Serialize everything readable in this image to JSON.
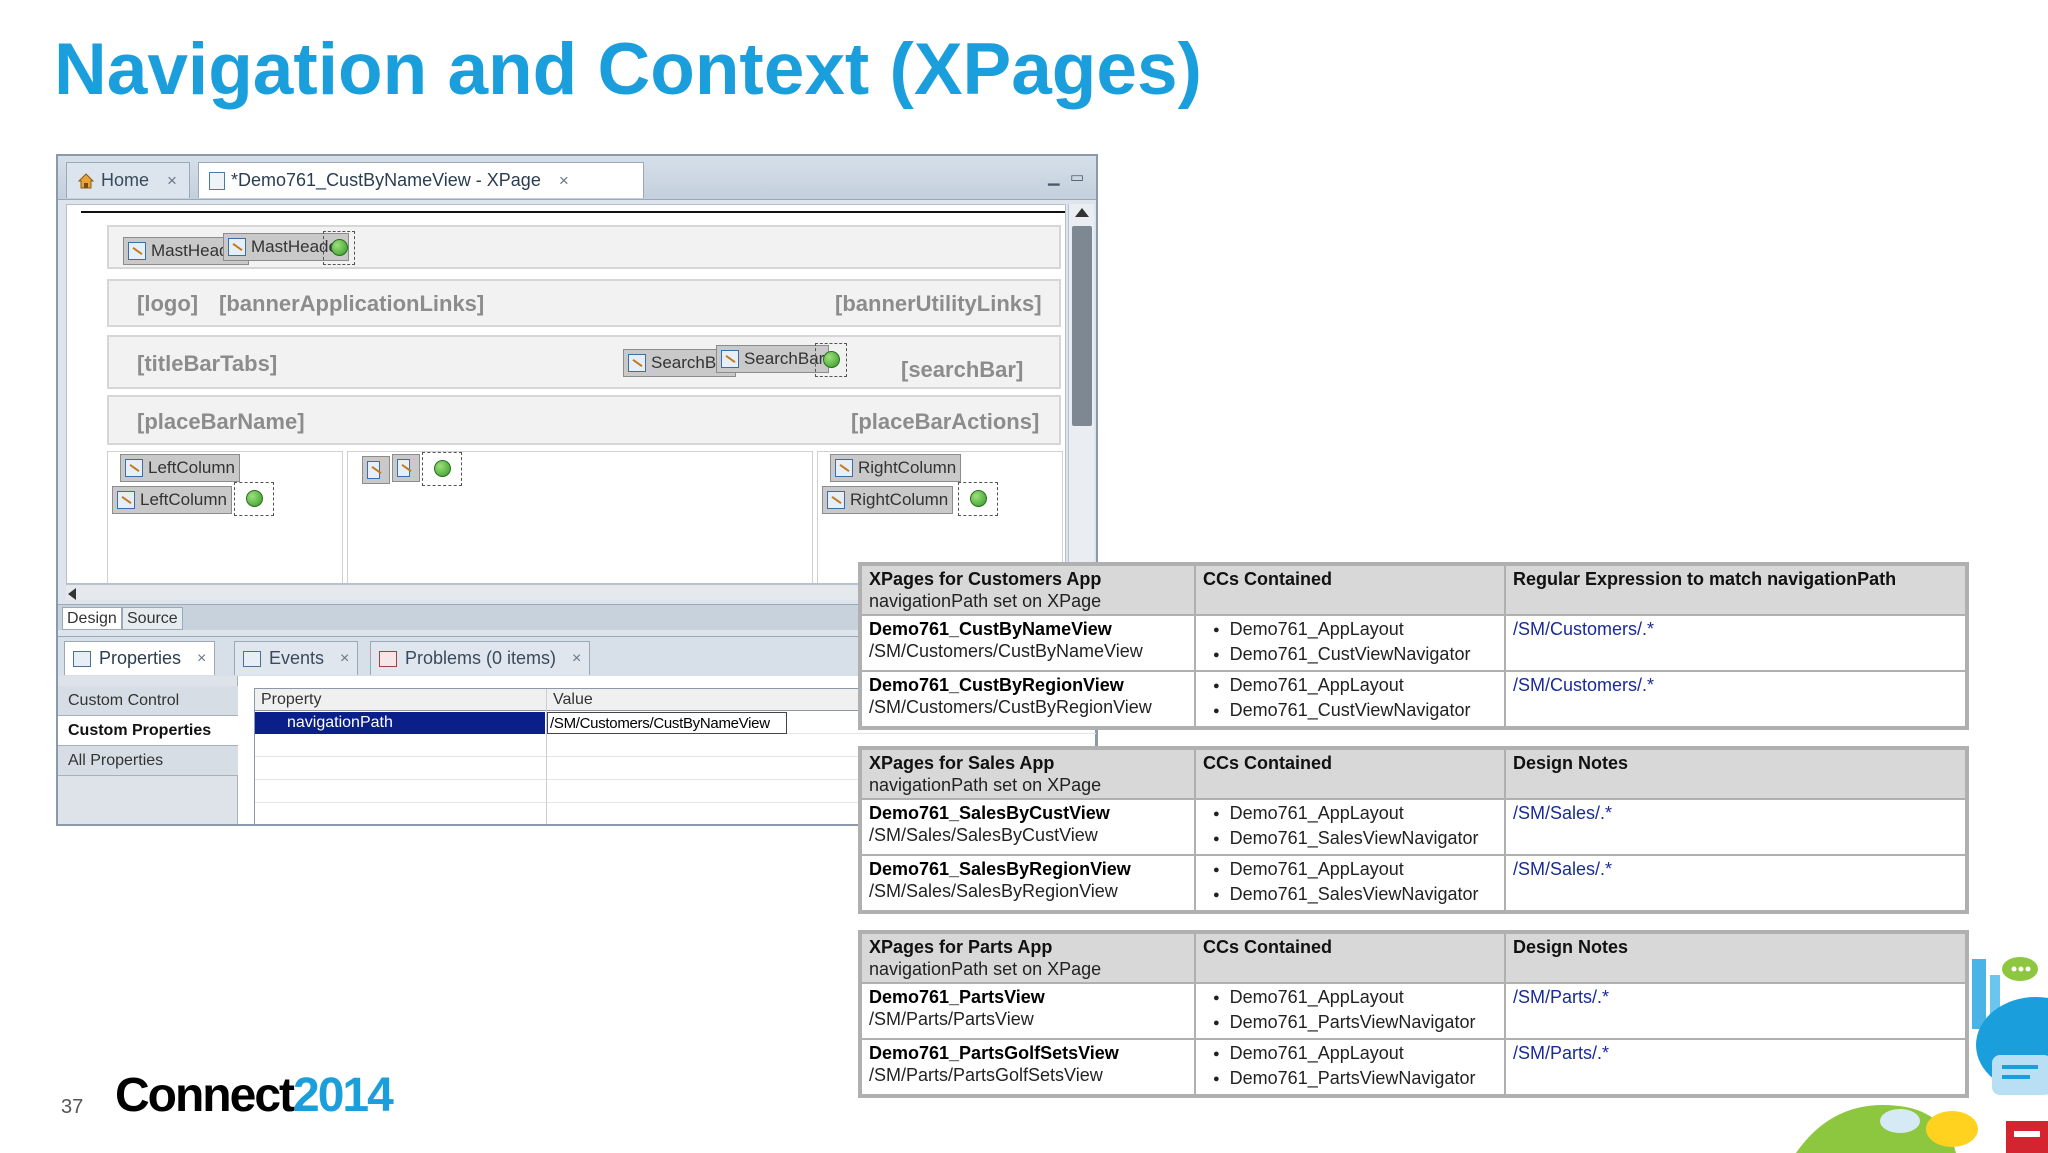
{
  "slide": {
    "title": "Navigation and Context (XPages)",
    "page_number": "37",
    "logo_word": "Connect",
    "logo_year": "2014"
  },
  "editor": {
    "tabs": [
      {
        "label": "Home",
        "close": "×"
      },
      {
        "label": "*Demo761_CustByNameView - XPage",
        "close": "×"
      }
    ],
    "window_controls": {
      "minimize": "▁",
      "maximize": "▭"
    },
    "canvas": {
      "mast_header": [
        "MastHeader",
        "MastHeader"
      ],
      "placeholders": {
        "logo": "[logo]",
        "banner_app_links": "[bannerApplicationLinks]",
        "banner_utility_links": "[bannerUtilityLinks]",
        "title_bar_tabs": "[titleBarTabs]",
        "search_bar": "[searchBar]",
        "place_bar_name": "[placeBarName]",
        "place_bar_actions": "[placeBarActions]"
      },
      "search_bar_ccs": [
        "SearchBar",
        "SearchBar"
      ],
      "left_column_ccs": [
        "LeftColumn",
        "LeftColumn"
      ],
      "right_column_ccs": [
        "RightColumn",
        "RightColumn"
      ]
    },
    "design_tabs": [
      "Design",
      "Source"
    ],
    "panel_tabs": [
      {
        "label": "Properties",
        "close": "×"
      },
      {
        "label": "Events",
        "close": "×"
      },
      {
        "label": "Problems (0 items)",
        "close": "×"
      }
    ],
    "side_nav": [
      "Custom Control",
      "Custom Properties",
      "All Properties"
    ],
    "grid": {
      "headers": [
        "Property",
        "Value"
      ],
      "row": {
        "property": "navigationPath",
        "value": "/SM/Customers/CustByNameView"
      }
    }
  },
  "tables": [
    {
      "header": {
        "col1_title": "XPages for Customers App",
        "col1_sub": "navigationPath set on XPage",
        "col2": "CCs Contained",
        "col3": "Regular Expression to match navigationPath"
      },
      "rows": [
        {
          "name": "Demo761_CustByNameView",
          "path": "/SM/Customers/CustByNameView",
          "ccs": [
            "Demo761_AppLayout",
            "Demo761_CustViewNavigator"
          ],
          "note": "/SM/Customers/.*"
        },
        {
          "name": "Demo761_CustByRegionView",
          "path": "/SM/Customers/CustByRegionView",
          "ccs": [
            "Demo761_AppLayout",
            "Demo761_CustViewNavigator"
          ],
          "note": "/SM/Customers/.*"
        }
      ]
    },
    {
      "header": {
        "col1_title": "XPages for Sales App",
        "col1_sub": "navigationPath set on XPage",
        "col2": "CCs Contained",
        "col3": "Design Notes"
      },
      "rows": [
        {
          "name": "Demo761_SalesByCustView",
          "path": "/SM/Sales/SalesByCustView",
          "ccs": [
            "Demo761_AppLayout",
            "Demo761_SalesViewNavigator"
          ],
          "note": "/SM/Sales/.*"
        },
        {
          "name": "Demo761_SalesByRegionView",
          "path": "/SM/Sales/SalesByRegionView",
          "ccs": [
            "Demo761_AppLayout",
            "Demo761_SalesViewNavigator"
          ],
          "note": "/SM/Sales/.*"
        }
      ]
    },
    {
      "header": {
        "col1_title": "XPages for Parts App",
        "col1_sub": "navigationPath set on XPage",
        "col2": "CCs Contained",
        "col3": "Design Notes"
      },
      "rows": [
        {
          "name": "Demo761_PartsView",
          "path": "/SM/Parts/PartsView",
          "ccs": [
            "Demo761_AppLayout",
            "Demo761_PartsViewNavigator"
          ],
          "note": "/SM/Parts/.*"
        },
        {
          "name": "Demo761_PartsGolfSetsView",
          "path": "/SM/Parts/PartsGolfSetsView",
          "ccs": [
            "Demo761_AppLayout",
            "Demo761_PartsViewNavigator"
          ],
          "note": "/SM/Parts/.*"
        }
      ]
    }
  ],
  "colors": {
    "title_blue": "#1a9fdc",
    "selection_navy": "#0a1f8a",
    "link_blue": "#1a2a9a"
  }
}
